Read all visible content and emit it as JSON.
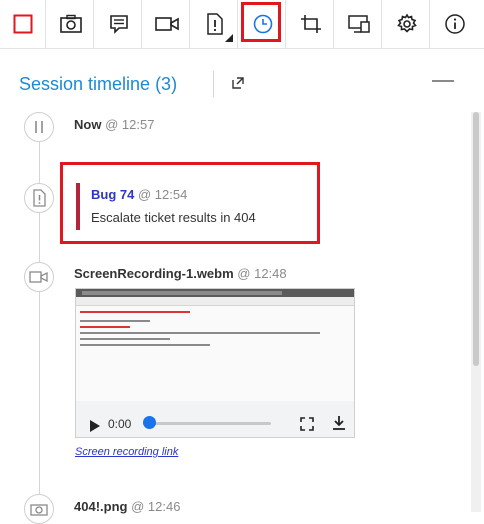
{
  "toolbar": {
    "buttons": [
      {
        "name": "stop-icon"
      },
      {
        "name": "camera-icon"
      },
      {
        "name": "note-icon"
      },
      {
        "name": "video-icon"
      },
      {
        "name": "bug-file-icon"
      },
      {
        "name": "timeline-clock-icon",
        "active": true
      },
      {
        "name": "crop-icon"
      },
      {
        "name": "devices-icon"
      },
      {
        "name": "gear-icon"
      },
      {
        "name": "info-icon"
      }
    ],
    "accent_color": "#e0171f"
  },
  "header": {
    "title": "Session timeline (3)",
    "title_color": "#1a8ad6"
  },
  "timeline": {
    "items": [
      {
        "title": "Now",
        "time": "@ 12:57",
        "icon": "pause-icon"
      },
      {
        "title": "Bug 74",
        "time": "@ 12:54",
        "description": "Escalate ticket results in 404",
        "icon": "bug-file-icon",
        "link_color": "#2c35c9"
      },
      {
        "title": "ScreenRecording-1.webm",
        "time": "@ 12:48",
        "icon": "video-icon",
        "player": {
          "time": "0:00"
        },
        "link": "Screen recording link"
      },
      {
        "title": "404!.png",
        "time": "@ 12:46",
        "icon": "camera-icon"
      }
    ]
  }
}
